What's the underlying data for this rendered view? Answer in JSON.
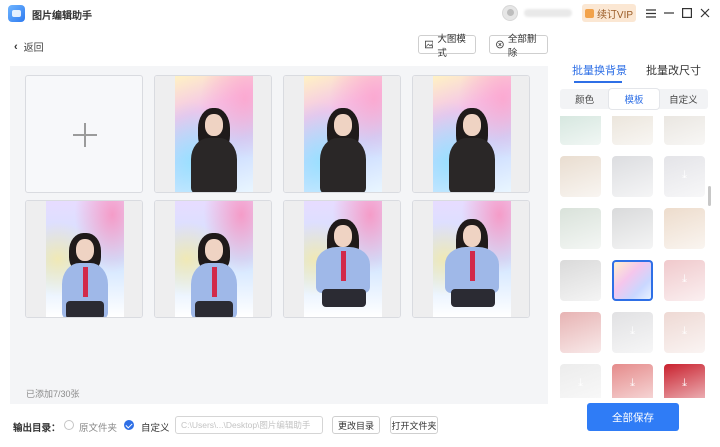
{
  "app": {
    "title": "图片编辑助手"
  },
  "account": {
    "vip_label": "续订VIP"
  },
  "window_controls": {
    "menu": "☰",
    "minimize": "—",
    "maximize": "☐",
    "close": "✕"
  },
  "toolbar": {
    "back_label": "返回",
    "view_mode_label": "大图模式",
    "delete_all_label": "全部删除"
  },
  "grid": {
    "count_text": "已添加7/30张",
    "images": [
      {
        "pose": "arms-crossed",
        "bg": "rainbow"
      },
      {
        "pose": "arms-crossed",
        "bg": "rainbow"
      },
      {
        "pose": "arms-crossed",
        "bg": "rainbow"
      },
      {
        "pose": "hands-up",
        "bg": "rainbow2"
      },
      {
        "pose": "hands-up",
        "bg": "rainbow2"
      },
      {
        "pose": "sitting",
        "bg": "rainbow2"
      },
      {
        "pose": "sitting",
        "bg": "rainbow2"
      }
    ]
  },
  "right_panel": {
    "tabs": [
      "批量换背景",
      "批量改尺寸"
    ],
    "active_tab": 0,
    "segments": [
      "颜色",
      "模板",
      "自定义"
    ],
    "active_segment": 1,
    "templates": [
      {
        "name": "mint-marble",
        "color": "#cfe3da",
        "download": false
      },
      {
        "name": "beige-texture",
        "color": "#e8e1d6",
        "download": false
      },
      {
        "name": "ink-mountain",
        "color": "#e6e2dc",
        "download": false
      },
      {
        "name": "misty-mountain-beige",
        "color": "#e9ddd0",
        "download": false
      },
      {
        "name": "ink-landscape",
        "color": "#dcdde0",
        "download": false
      },
      {
        "name": "cloud-mountain",
        "color": "#e4e4e8",
        "download": true
      },
      {
        "name": "sage-paper",
        "color": "#d9e2da",
        "download": false
      },
      {
        "name": "grey-mist",
        "color": "#d9dadb",
        "download": false
      },
      {
        "name": "floral-cream",
        "color": "#eddccc",
        "download": false
      },
      {
        "name": "silver-wave",
        "color": "#dadada",
        "download": false
      },
      {
        "name": "rainbow-light",
        "color": "#e6e3f6",
        "download": false,
        "selected": true
      },
      {
        "name": "pink-soft",
        "color": "#f0c9cc",
        "download": true
      },
      {
        "name": "red-floral",
        "color": "#e7b3b3",
        "download": false
      },
      {
        "name": "white-lines",
        "color": "#e1e1e3",
        "download": true
      },
      {
        "name": "blush-pink",
        "color": "#eed9d4",
        "download": true
      },
      {
        "name": "light-grey",
        "color": "#ececec",
        "download": true
      },
      {
        "name": "coral-red",
        "color": "#e58b8b",
        "download": true
      },
      {
        "name": "crimson",
        "color": "#c9212e",
        "download": true
      }
    ],
    "save_label": "全部保存"
  },
  "output": {
    "label": "输出目录：",
    "option_original": "原文件夹",
    "option_custom": "自定义",
    "selected": "custom",
    "path": "C:\\Users\\...\\Desktop\\图片编辑助手",
    "change_dir_label": "更改目录",
    "open_folder_label": "打开文件夹"
  }
}
